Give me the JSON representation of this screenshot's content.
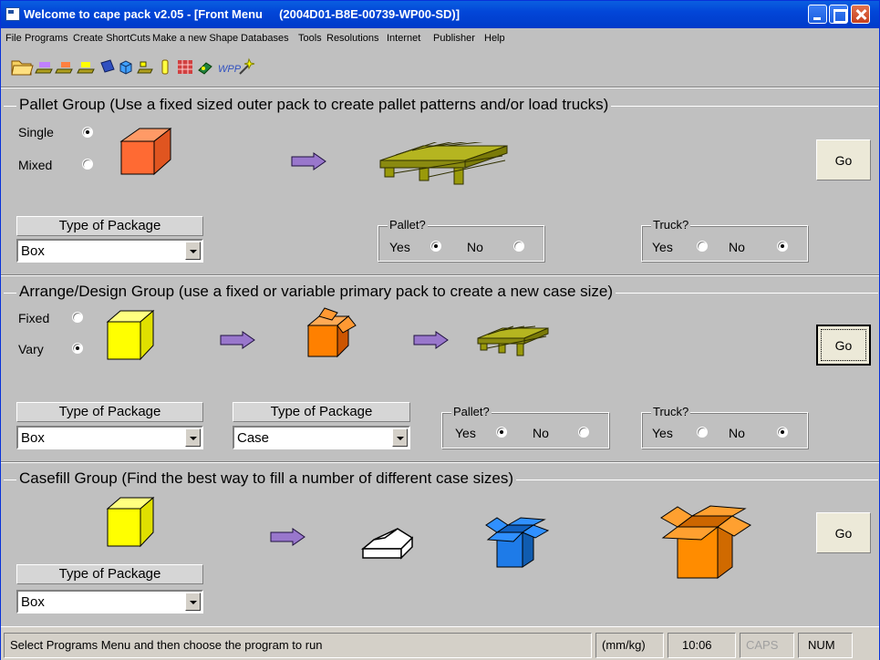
{
  "window": {
    "title": "Welcome to cape pack v2.05 - [Front Menu",
    "subtitle": "(2004D01-B8E-00739-WP00-SD)]"
  },
  "menu": [
    "File",
    "Programs",
    "Create ShortCuts",
    "Make a new Shape",
    "Databases",
    "Tools",
    "Resolutions",
    "Internet",
    "Publisher",
    "Help"
  ],
  "toolbar": {
    "icons": [
      "open-folder-icon",
      "pallet-tool-icon",
      "pallet-tool-2-icon",
      "pallet-tool-3-icon",
      "book-icon",
      "cube-icon",
      "arrange-tool-icon",
      "bottle-icon",
      "pallet-pattern-icon",
      "paint-icon",
      "wpp-icon",
      "magic-wand-icon"
    ],
    "wpp_label": "WPP"
  },
  "pallet_group": {
    "title": "Pallet Group (Use a fixed sized outer pack to create pallet patterns and/or load trucks)",
    "single_label": "Single",
    "mixed_label": "Mixed",
    "single_checked": true,
    "mixed_checked": false,
    "go_label": "Go",
    "package_header": "Type of Package",
    "package_value": "Box",
    "pallet_legend": "Pallet?",
    "pallet_yes": "Yes",
    "pallet_no": "No",
    "pallet_selected": "Yes",
    "truck_legend": "Truck?",
    "truck_yes": "Yes",
    "truck_no": "No",
    "truck_selected": "No"
  },
  "arrange_group": {
    "title": "Arrange/Design Group (use a fixed or variable primary pack to create a new case size)",
    "fixed_label": "Fixed",
    "vary_label": "Vary",
    "fixed_checked": false,
    "vary_checked": true,
    "go_label": "Go",
    "package1_header": "Type of Package",
    "package1_value": "Box",
    "package2_header": "Type of Package",
    "package2_value": "Case",
    "pallet_legend": "Pallet?",
    "pallet_yes": "Yes",
    "pallet_no": "No",
    "pallet_selected": "Yes",
    "truck_legend": "Truck?",
    "truck_yes": "Yes",
    "truck_no": "No",
    "truck_selected": "No"
  },
  "casefill_group": {
    "title": "Casefill Group (Find the best way to fill a number of different case sizes)",
    "go_label": "Go",
    "package_header": "Type of Package",
    "package_value": "Box"
  },
  "status": {
    "message": "Select Programs Menu and then choose the program to run",
    "units": "(mm/kg)",
    "time": "10:06",
    "caps": "CAPS",
    "num": "NUM"
  },
  "colors": {
    "titlebar": "#0246d8",
    "background": "#c0c0c0",
    "orange_box": "#ff6a33",
    "yellow_box": "#ffff00",
    "pallet": "#9a9a0a",
    "arrow": "#9977cc",
    "blue_box": "#1e7be8",
    "orange_case": "#ff8c00"
  }
}
